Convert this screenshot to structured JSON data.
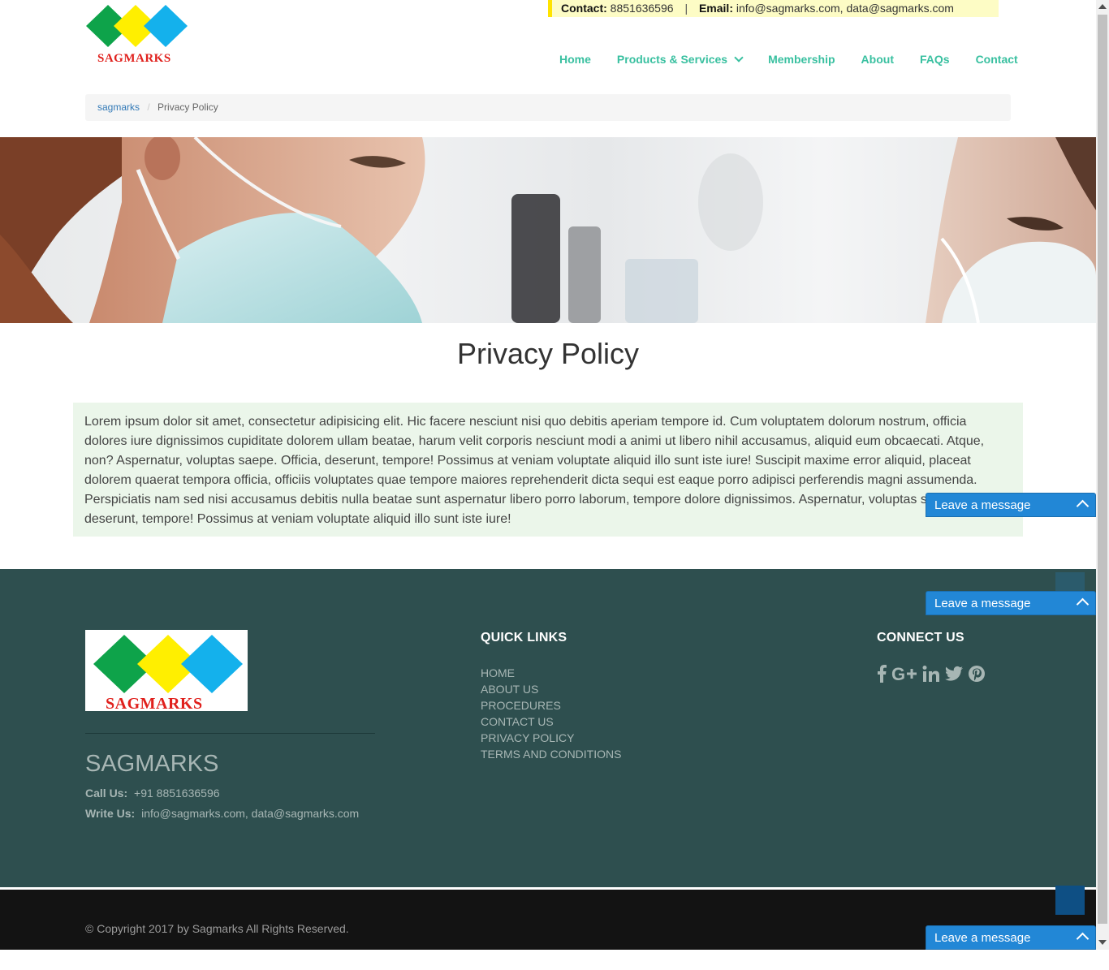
{
  "header": {
    "logo_text": "SAGMARKS",
    "contact_label": "Contact:",
    "contact_phone": "8851636596",
    "separator": "|",
    "email_label": "Email:",
    "email_value": "info@sagmarks.com, data@sagmarks.com"
  },
  "nav": {
    "items": [
      "Home",
      "Products & Services",
      "Membership",
      "About",
      "FAQs",
      "Contact"
    ]
  },
  "breadcrumb": {
    "home": "sagmarks",
    "separator": "/",
    "current": "Privacy Policy"
  },
  "main": {
    "title": "Privacy Policy",
    "body": "Lorem ipsum dolor sit amet, consectetur adipisicing elit. Hic facere nesciunt nisi quo debitis aperiam tempore id. Cum voluptatem dolorum nostrum, officia dolores iure dignissimos cupiditate dolorem ullam beatae, harum velit corporis nesciunt modi a animi ut libero nihil accusamus, aliquid eum obcaecati. Atque, non? Aspernatur, voluptas saepe. Officia, deserunt, tempore! Possimus at veniam voluptate aliquid illo sunt iste iure! Suscipit maxime error aliquid, placeat dolorem quaerat tempora officia, officiis voluptates quae tempore maiores reprehenderit dicta sequi est eaque porro adipisci perferendis magni assumenda. Perspiciatis nam sed nisi accusamus debitis nulla beatae sunt aspernatur libero porro laborum, tempore dolore dignissimos. Aspernatur, voluptas saepe. Officia, deserunt, tempore! Possimus at veniam voluptate aliquid illo sunt iste iure!"
  },
  "footer": {
    "logo_text": "SAGMARKS",
    "company": "SAGMARKS",
    "call_label": "Call Us:",
    "call_value": "+91 8851636596",
    "write_label": "Write Us:",
    "write_value": "info@sagmarks.com, data@sagmarks.com",
    "quick_links_title": "QUICK LINKS",
    "quick_links": [
      "HOME",
      "ABOUT US",
      "PROCEDURES",
      "CONTACT US",
      "PRIVACY POLICY",
      "TERMS AND CONDITIONS"
    ],
    "connect_title": "CONNECT US",
    "social_icons": [
      "facebook-icon",
      "google-plus-icon",
      "linkedin-icon",
      "twitter-icon",
      "pinterest-icon"
    ],
    "copyright": "© Copyright 2017 by Sagmarks All Rights Reserved."
  },
  "chat_widget": {
    "label": "Leave a message"
  },
  "colors": {
    "nav_green": "#39c0a0",
    "footer_bg": "#2e4f4f",
    "chat_blue": "#2287d6",
    "policy_bg": "#ebf6ea",
    "highlight_yellow": "#fdfcc5"
  }
}
